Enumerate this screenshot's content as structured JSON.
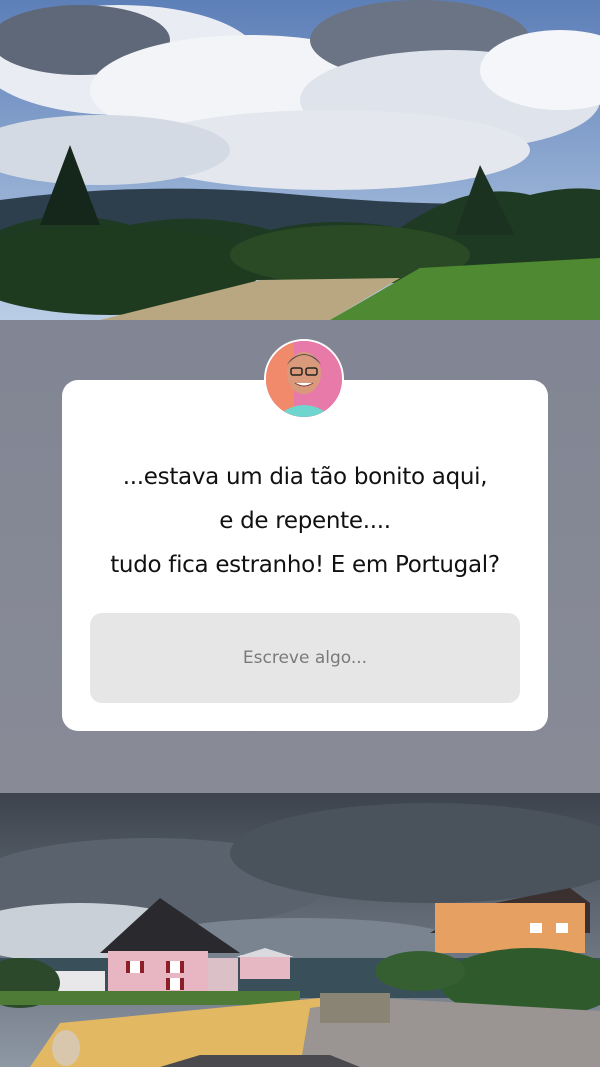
{
  "question": {
    "lines": [
      "...estava um dia tão bonito aqui,",
      "e de repente....",
      "tudo fica estranho! E em Portugal?"
    ]
  },
  "answer": {
    "placeholder": "Escreve algo..."
  },
  "colors": {
    "background": "#838694",
    "card": "#ffffff",
    "input": "#e6e6e6",
    "avatar_ring": "#e96a9a"
  }
}
